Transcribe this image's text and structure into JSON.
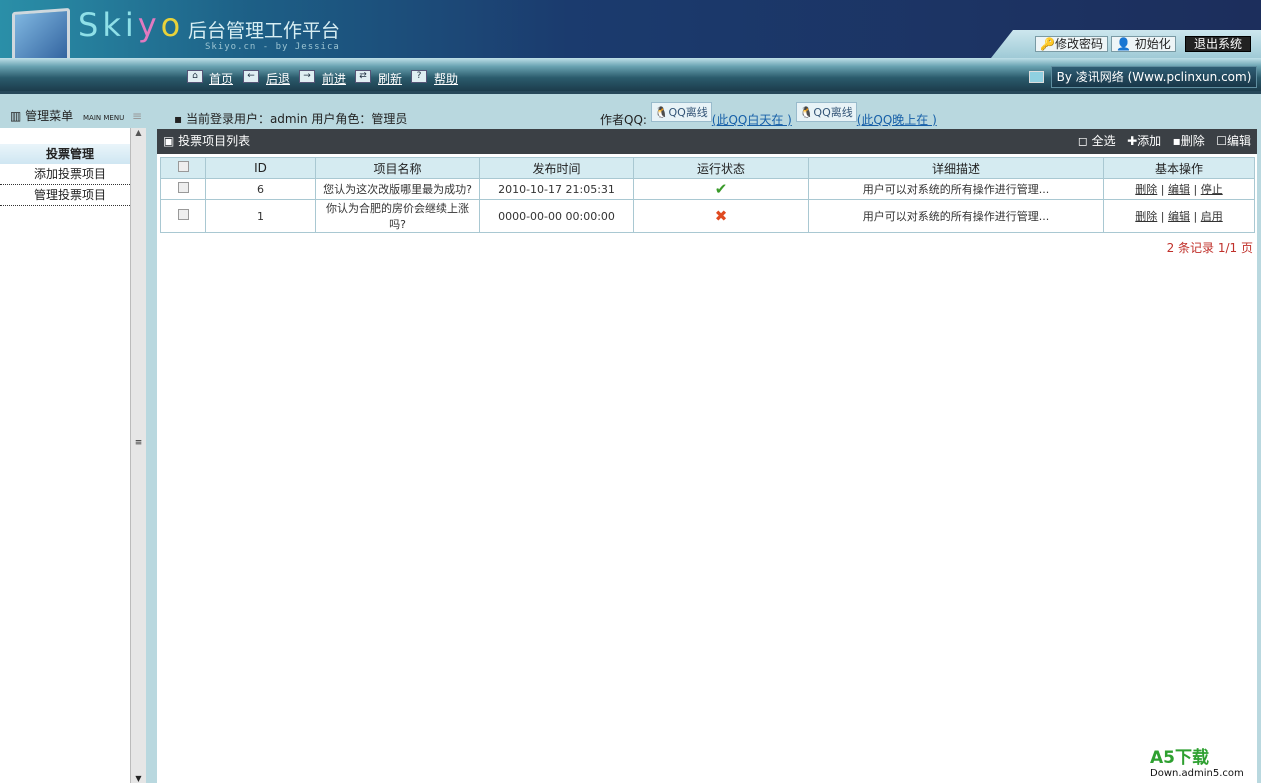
{
  "header": {
    "logo": "Skiyo",
    "title": "后台管理工作平台",
    "subtitle": "Skiyo.cn - by Jessica",
    "buttons": [
      "修改密码",
      "初始化",
      "退出系统"
    ]
  },
  "nav": {
    "items": [
      "首页",
      "后退",
      "前进",
      "刷新",
      "帮助"
    ],
    "by": "By 凌讯网络 (Www.pclinxun.com)"
  },
  "sidebar": {
    "title": "管理菜单",
    "title_en": "MAIN MENU",
    "group": "投票管理",
    "items": [
      "添加投票项目",
      "管理投票项目"
    ]
  },
  "userinfo": "当前登录用户：admin  用户角色：管理员",
  "qq": {
    "label": "作者QQ:",
    "badge": "QQ离线",
    "links": [
      "(此QQ白天在 )",
      "(此QQ晚上在 )"
    ]
  },
  "panel": {
    "title": "投票项目列表",
    "actions": [
      "全选",
      "添加",
      "删除",
      "编辑"
    ],
    "columns": [
      "ID",
      "项目名称",
      "发布时间",
      "运行状态",
      "详细描述",
      "基本操作"
    ],
    "rows": [
      {
        "id": "6",
        "name": "您认为这次改版哪里最为成功?",
        "time": "2010-10-17 21:05:31",
        "status": "✔",
        "desc": "用户可以对系统的所有操作进行管理...",
        "ops": [
          "删除",
          "编辑",
          "停止"
        ]
      },
      {
        "id": "1",
        "name": "你认为合肥的房价会继续上涨吗?",
        "time": "0000-00-00 00:00:00",
        "status": "✖",
        "desc": "用户可以对系统的所有操作进行管理...",
        "ops": [
          "删除",
          "编辑",
          "启用"
        ]
      }
    ],
    "pager": "2 条记录  1/1 页"
  },
  "watermark": {
    "main": "A5下载",
    "sub": "Down.admin5.com"
  }
}
